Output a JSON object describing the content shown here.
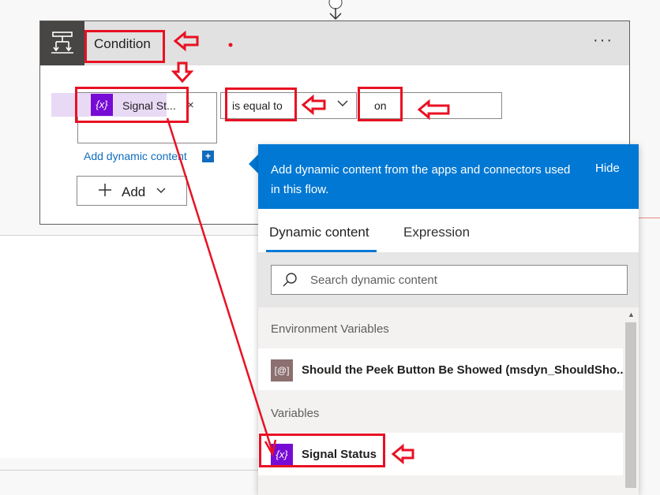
{
  "condition": {
    "title": "Condition",
    "more_label": "···",
    "left_operand": {
      "token_label": "Signal St...",
      "token_icon": "{x}",
      "remove_label": "×"
    },
    "add_dynamic_content_label": "Add dynamic content",
    "add_dynamic_content_plus": "+",
    "operator": "is equal to",
    "right_operand_value": "on",
    "add_button_label": "Add"
  },
  "flyout": {
    "description": "Add dynamic content from the apps and connectors used in this flow.",
    "hide_label": "Hide",
    "tabs": [
      {
        "label": "Dynamic content",
        "active": true
      },
      {
        "label": "Expression",
        "active": false
      }
    ],
    "search_placeholder": "Search dynamic content",
    "groups": [
      {
        "label": "Environment Variables",
        "items": [
          {
            "label": "Should the Peek Button Be Showed (msdyn_ShouldSho...",
            "icon": "[@]",
            "icon_color": "#8c6f6f"
          }
        ]
      },
      {
        "label": "Variables",
        "items": [
          {
            "label": "Signal Status",
            "icon": "{x}",
            "icon_color": "#770bd6"
          }
        ]
      }
    ]
  },
  "colors": {
    "accent": "#0078d4",
    "variable_purple": "#770bd6",
    "annotation_red": "#e81123"
  },
  "icons": [
    "condition-icon",
    "more-icon",
    "variable-icon",
    "close-icon",
    "chevron-down-icon",
    "plus-icon",
    "search-icon",
    "environment-variable-icon",
    "scroll-up-icon"
  ]
}
